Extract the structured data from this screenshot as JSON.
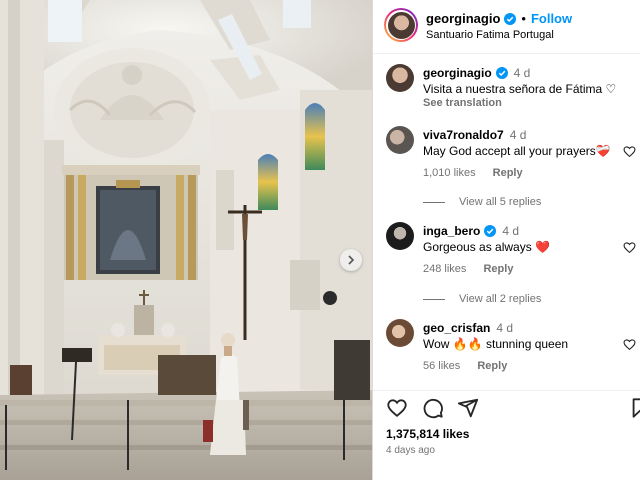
{
  "post": {
    "username": "georginagio",
    "follow_label": "Follow",
    "location": "Santuario Fatima Portugal",
    "caption_user": "georginagio",
    "caption_time": "4 d",
    "caption_text": "Visita a nuestra señora de Fátima ♡",
    "see_translation": "See translation",
    "likes": "1,375,814 likes",
    "posted_ago": "4 days ago"
  },
  "comments": [
    {
      "user": "viva7ronaldo7",
      "time": "4 d",
      "text": "May God accept all your prayers❤️‍🩹",
      "likes": "1,010 likes",
      "reply": "Reply",
      "view_replies": "View all 5 replies"
    },
    {
      "user": "inga_bero",
      "time": "4 d",
      "text": "Gorgeous as always ❤️",
      "likes": "248 likes",
      "reply": "Reply",
      "view_replies": "View all 2 replies"
    },
    {
      "user": "geo_crisfan",
      "time": "4 d",
      "text": "Wow 🔥🔥 stunning queen",
      "likes": "56 likes",
      "reply": "Reply"
    }
  ],
  "icons": {
    "verified": "verified-badge-icon",
    "like": "heart-icon",
    "comment": "comment-icon",
    "share": "share-icon",
    "save": "bookmark-icon",
    "next": "chevron-right-icon"
  },
  "colors": {
    "accent": "#0095f6",
    "muted": "#737373",
    "heart_red": "#ed4956"
  }
}
